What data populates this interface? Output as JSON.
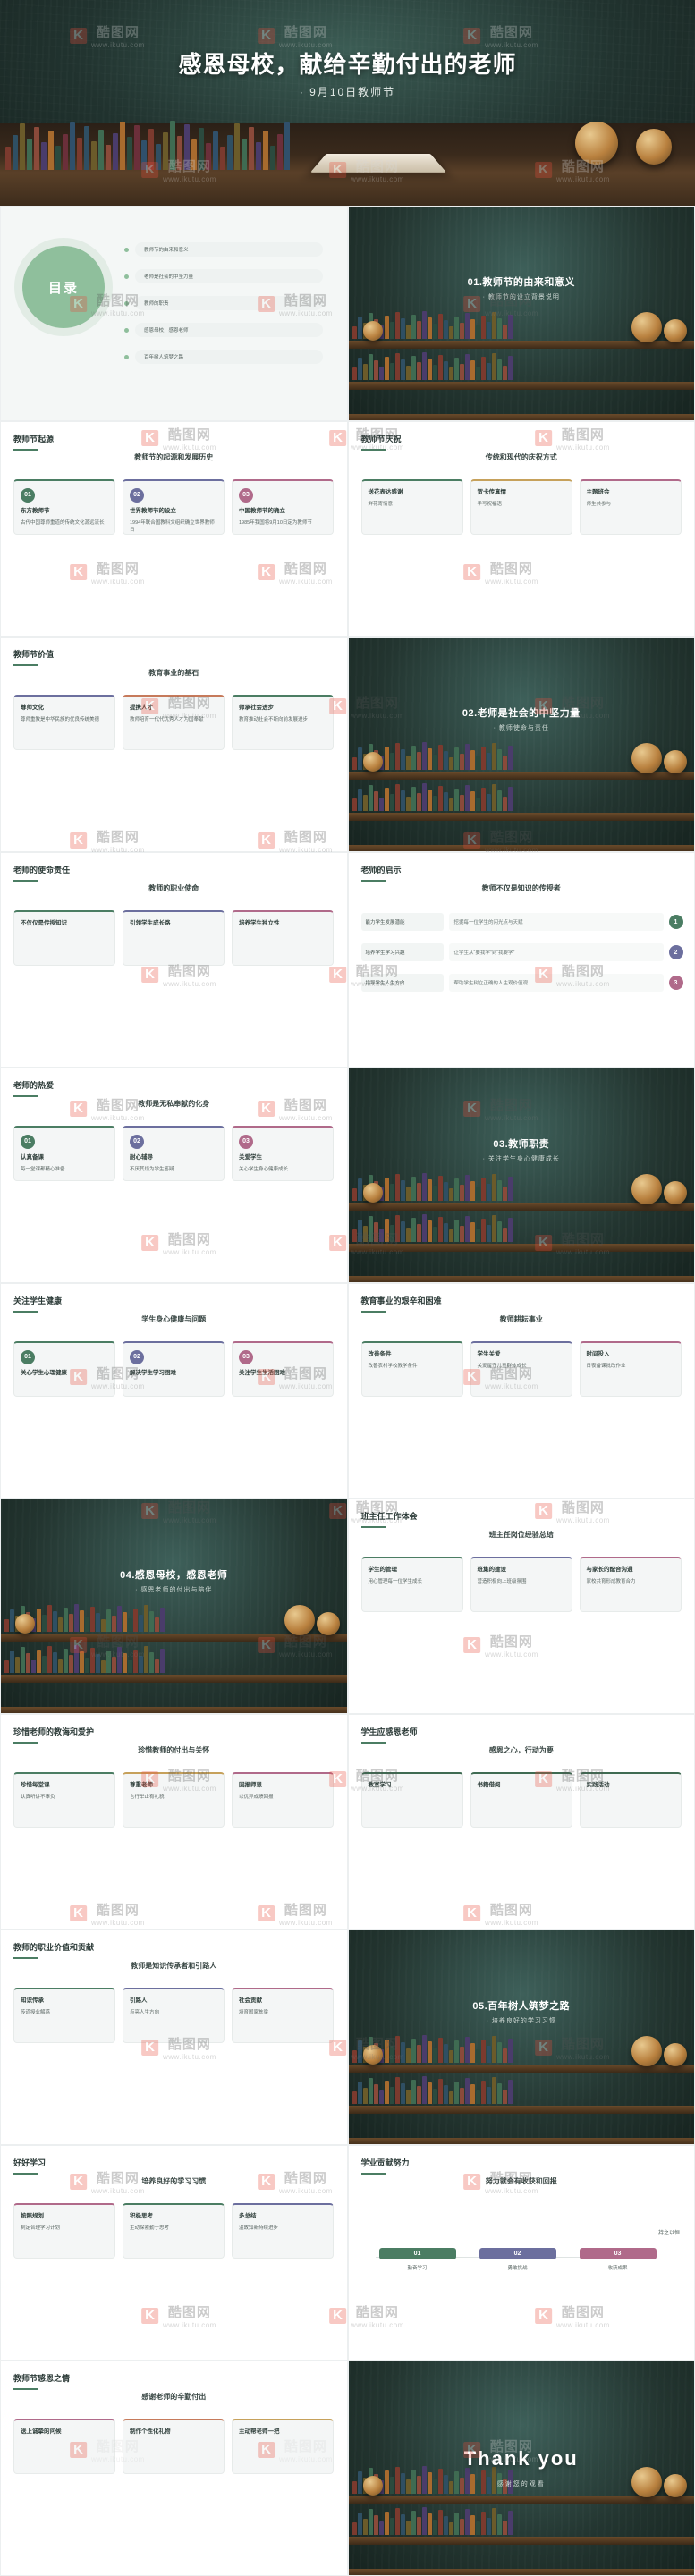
{
  "watermark": {
    "brand": "K",
    "name": "酷图网",
    "url": "www.ikutu.com"
  },
  "hero": {
    "title": "感恩母校，献给辛勤付出的老师",
    "subtitle": "· 9月10日教师节"
  },
  "contents": {
    "title": "目录",
    "items": [
      "教师节的由来和意义",
      "老师是社会的中坚力量",
      "教师的职责",
      "感恩母校，感恩老师",
      "百年树人筑梦之路"
    ]
  },
  "slides": [
    {
      "id": "s01",
      "kind": "dark",
      "number": "01.教师节的由来和意义",
      "subtitle": "· 教师节的设立背景说明"
    },
    {
      "id": "s02",
      "kind": "light",
      "title": "教师节起源",
      "center": "教师节的起源和发展历史",
      "cards": [
        {
          "badge": "01",
          "badge_color": "#4b7d63",
          "heading": "东方教师节",
          "body": "古代中国尊师重道的传统文化源远流长"
        },
        {
          "badge": "02",
          "badge_color": "#6c6f9e",
          "heading": "世界教师节的设立",
          "body": "1994年联合国教科文组织确立世界教师日"
        },
        {
          "badge": "03",
          "badge_color": "#b06a8a",
          "heading": "中国教师节的确立",
          "body": "1985年我国将9月10日定为教师节"
        }
      ]
    },
    {
      "id": "s03",
      "kind": "light",
      "title": "教师节庆祝",
      "center": "传统和现代的庆祝方式",
      "cards": [
        {
          "badge": "",
          "badge_color": "#4b7d63",
          "heading": "送花表达感谢",
          "body": "鲜花寄情意"
        },
        {
          "badge": "",
          "badge_color": "#c6a15b",
          "heading": "贺卡传真情",
          "body": "手写祝福语"
        },
        {
          "badge": "",
          "badge_color": "#b06a8a",
          "heading": "主题班会",
          "body": "师生共参与"
        }
      ]
    },
    {
      "id": "s04",
      "kind": "light",
      "title": "教师节价值",
      "center": "教育事业的基石",
      "cards": [
        {
          "badge": "",
          "badge_color": "#6c6f9e",
          "heading": "尊师文化",
          "body": "尊师重教是中华民族的优良传统美德"
        },
        {
          "badge": "",
          "badge_color": "#c67a5b",
          "heading": "提携人才",
          "body": "教师培育一代代优秀人才为国奉献"
        },
        {
          "badge": "",
          "badge_color": "#4b7d63",
          "heading": "师承社会进步",
          "body": "教育推动社会不断向前发展进步"
        }
      ]
    },
    {
      "id": "s05",
      "kind": "dark",
      "number": "02.老师是社会的中坚力量",
      "subtitle": "· 教师使命与责任"
    },
    {
      "id": "s06",
      "kind": "light",
      "title": "老师的使命责任",
      "center": "教师的职业使命",
      "cards": [
        {
          "badge": "",
          "badge_color": "#4b7d63",
          "heading": "不仅仅是传授知识",
          "body": ""
        },
        {
          "badge": "",
          "badge_color": "#6c6f9e",
          "heading": "引领学生成长路",
          "body": ""
        },
        {
          "badge": "",
          "badge_color": "#b06a8a",
          "heading": "培养学生独立性",
          "body": ""
        }
      ]
    },
    {
      "id": "s07",
      "kind": "light",
      "title": "老师的启示",
      "center": "教师不仅是知识的传授者",
      "rows": [
        {
          "label": "能力学生发展潜能",
          "value": "挖掘每一位学生的闪光点与天赋",
          "n": "1",
          "color": "#4b7d63"
        },
        {
          "label": "培养学生学习兴趣",
          "value": "让学生从“要我学”到“我要学”",
          "n": "2",
          "color": "#6c6f9e"
        },
        {
          "label": "指导学生人生方向",
          "value": "帮助学生树立正确的人生观价值观",
          "n": "3",
          "color": "#b06a8a"
        }
      ]
    },
    {
      "id": "s08",
      "kind": "light",
      "title": "老师的热爱",
      "center": "教师是无私奉献的化身",
      "cards": [
        {
          "badge": "01",
          "badge_color": "#4b7d63",
          "heading": "认真备课",
          "body": "每一堂课都精心准备"
        },
        {
          "badge": "02",
          "badge_color": "#6c6f9e",
          "heading": "耐心辅导",
          "body": "不厌其烦为学生答疑"
        },
        {
          "badge": "03",
          "badge_color": "#b06a8a",
          "heading": "关爱学生",
          "body": "关心学生身心健康成长"
        }
      ]
    },
    {
      "id": "s09",
      "kind": "dark",
      "number": "03.教师职责",
      "subtitle": "· 关注学生身心健康成长"
    },
    {
      "id": "s10",
      "kind": "light",
      "title": "关注学生健康",
      "center": "学生身心健康与问题",
      "cards": [
        {
          "badge": "01",
          "badge_color": "#4b7d63",
          "heading": "关心学生心理健康",
          "body": ""
        },
        {
          "badge": "02",
          "badge_color": "#6c6f9e",
          "heading": "解决学生学习困难",
          "body": ""
        },
        {
          "badge": "03",
          "badge_color": "#b06a8a",
          "heading": "关注学生生活困难",
          "body": ""
        }
      ]
    },
    {
      "id": "s11",
      "kind": "light",
      "title": "教育事业的艰辛和困难",
      "center": "教师耕耘事业",
      "cards": [
        {
          "badge": "",
          "badge_color": "#4b7d63",
          "heading": "改善条件",
          "body": "改善农村学校教学条件"
        },
        {
          "badge": "",
          "badge_color": "#6c6f9e",
          "heading": "学生关爱",
          "body": "关爱留守儿童群体成长"
        },
        {
          "badge": "",
          "badge_color": "#b06a8a",
          "heading": "时间投入",
          "body": "日夜备课批改作业"
        }
      ]
    },
    {
      "id": "s12",
      "kind": "dark",
      "number": "04.感恩母校，感恩老师",
      "subtitle": "· 感恩老师的付出与陪伴"
    },
    {
      "id": "s13",
      "kind": "light",
      "title": "班主任工作体会",
      "center": "班主任岗位经验总结",
      "cards": [
        {
          "badge": "",
          "badge_color": "#4b7d63",
          "heading": "学生的管理",
          "body": "用心管理每一位学生成长"
        },
        {
          "badge": "",
          "badge_color": "#6c6f9e",
          "heading": "班集的建设",
          "body": "营造积极向上班级氛围"
        },
        {
          "badge": "",
          "badge_color": "#b06a8a",
          "heading": "与家长的配合沟通",
          "body": "家校共育形成教育合力"
        }
      ]
    },
    {
      "id": "s14",
      "kind": "light",
      "title": "珍惜老师的教诲和爱护",
      "center": "珍惜教师的付出与关怀",
      "cards": [
        {
          "badge": "",
          "badge_color": "#4b7d63",
          "heading": "珍惜每堂课",
          "body": "认真听讲不辜负"
        },
        {
          "badge": "",
          "badge_color": "#c6a15b",
          "heading": "尊重老师",
          "body": "言行举止有礼貌"
        },
        {
          "badge": "",
          "badge_color": "#b06a8a",
          "heading": "回报师恩",
          "body": "以优异成绩回报"
        }
      ]
    },
    {
      "id": "s15",
      "kind": "light",
      "title": "学生应感恩老师",
      "center": "感恩之心，行动为要",
      "cards": [
        {
          "badge": "",
          "badge_color": "#3f6b52",
          "heading": "教室学习",
          "body": ""
        },
        {
          "badge": "",
          "badge_color": "#3f6b52",
          "heading": "书籍借阅",
          "body": ""
        },
        {
          "badge": "",
          "badge_color": "#3f6b52",
          "heading": "实践活动",
          "body": ""
        }
      ]
    },
    {
      "id": "s16",
      "kind": "light",
      "title": "教师的职业价值和贡献",
      "center": "教师是知识传承者和引路人",
      "cards": [
        {
          "badge": "",
          "badge_color": "#4b7d63",
          "heading": "知识传承",
          "body": "传道授业解惑"
        },
        {
          "badge": "",
          "badge_color": "#6c6f9e",
          "heading": "引路人",
          "body": "点亮人生方向"
        },
        {
          "badge": "",
          "badge_color": "#b06a8a",
          "heading": "社会贡献",
          "body": "培育国家栋梁"
        }
      ]
    },
    {
      "id": "s17",
      "kind": "dark",
      "number": "05.百年树人筑梦之路",
      "subtitle": "· 培养良好的学习习惯"
    },
    {
      "id": "s18",
      "kind": "light",
      "title": "好好学习",
      "center": "培养良好的学习习惯",
      "cards": [
        {
          "badge": "",
          "badge_color": "#b06a8a",
          "heading": "按照规划",
          "body": "制定合理学习计划"
        },
        {
          "badge": "",
          "badge_color": "#4b7d63",
          "heading": "积极思考",
          "body": "主动探索勤于思考"
        },
        {
          "badge": "",
          "badge_color": "#6c6f9e",
          "heading": "多总结",
          "body": "温故知新持续进步"
        }
      ]
    },
    {
      "id": "s19",
      "kind": "light",
      "title": "学业贡献努力",
      "center": "努力就会有收获和回报",
      "steps": [
        {
          "n": "01",
          "label": "勤奋学习",
          "color": "#4b7d63"
        },
        {
          "n": "02",
          "label": "勇敢挑战",
          "color": "#6c6f9e"
        },
        {
          "n": "03",
          "label": "收获成果",
          "color": "#b06a8a"
        }
      ],
      "right_label": "持之以恒"
    },
    {
      "id": "s20",
      "kind": "light",
      "title": "教师节感恩之情",
      "center": "感谢老师的辛勤付出",
      "cards": [
        {
          "badge": "",
          "badge_color": "#b06a8a",
          "heading": "送上诚挚的问候",
          "body": ""
        },
        {
          "badge": "",
          "badge_color": "#c67a5b",
          "heading": "制作个性化礼物",
          "body": ""
        },
        {
          "badge": "",
          "badge_color": "#c6a15b",
          "heading": "主动帮老师一把",
          "body": ""
        }
      ]
    },
    {
      "id": "s21",
      "kind": "dark",
      "thanks": "Thank you",
      "thanks_sub": "感谢您的观看"
    }
  ],
  "colors": {
    "green": "#4b7d63",
    "mint": "#8fbf9c",
    "purple": "#6c6f9e",
    "pink": "#b06a8a",
    "gold": "#c6a15b",
    "dark_board": "#233530"
  }
}
